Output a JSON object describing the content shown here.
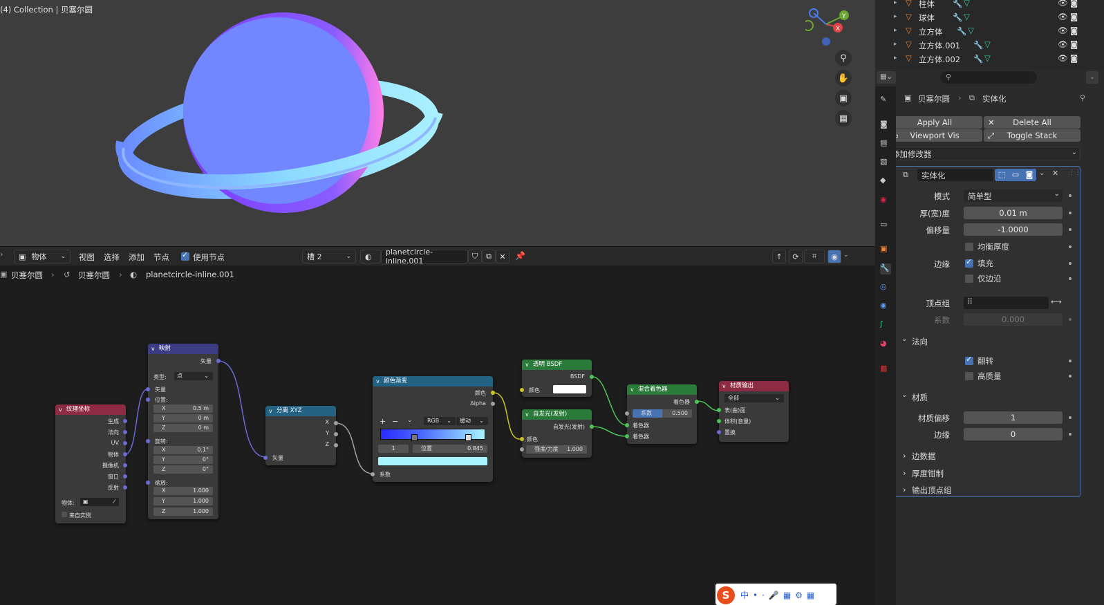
{
  "viewport": {
    "title": "(4) Collection | 贝塞尔圆"
  },
  "node_header": {
    "mode_label": "物体",
    "menu": [
      "视图",
      "选择",
      "添加",
      "节点"
    ],
    "use_nodes_label": "使用节点",
    "slot_label": "槽 2",
    "material_name": "planetcircle-inline.001"
  },
  "breadcrumb": {
    "object": "贝塞尔圆",
    "curve": "贝塞尔圆",
    "material": "planetcircle-inline.001"
  },
  "outliner": {
    "items": [
      {
        "name": "柱体"
      },
      {
        "name": "球体"
      },
      {
        "name": "立方体"
      },
      {
        "name": "立方体.001"
      },
      {
        "name": "立方体.002"
      }
    ]
  },
  "properties": {
    "breadcrumb_object": "贝塞尔圆",
    "breadcrumb_modifier": "实体化",
    "apply_all": "Apply All",
    "delete_all": "Delete All",
    "viewport_vis": "Viewport Vis",
    "toggle_stack": "Toggle Stack",
    "add_modifier": "添加修改器",
    "modifier_name": "实体化",
    "mode_label": "模式",
    "mode_value": "简单型",
    "thickness_label": "厚(宽)度",
    "thickness_value": "0.01 m",
    "offset_label": "偏移量",
    "offset_value": "-1.0000",
    "even_label": "均衡厚度",
    "rim_label": "边缘",
    "fill_label": "填充",
    "rim_only_label": "仅边沿",
    "vgroup_label": "顶点组",
    "factor_label": "系数",
    "factor_value": "0.000",
    "normals_section": "法向",
    "flip_label": "翻转",
    "hq_label": "高质量",
    "material_section": "材质",
    "mat_offset_label": "材质偏移",
    "mat_offset_value": "1",
    "rim_mat_label": "边缘",
    "rim_mat_value": "0",
    "edge_data_section": "边数据",
    "thickness_clamp_section": "厚度钳制",
    "output_vgroups_section": "输出顶点组"
  },
  "nodes": {
    "texcoord": {
      "title": "纹理坐标",
      "outputs": [
        "生成",
        "法向",
        "UV",
        "物体",
        "摄像机",
        "窗口",
        "反射"
      ],
      "object_label": "物体:",
      "instancer_label": "来自实例"
    },
    "mapping": {
      "title": "映射",
      "out": "矢量",
      "type_label": "类型:",
      "type_value": "点",
      "vector": "矢量",
      "location": "位置:",
      "rotation": "旋转:",
      "scale": "缩放:",
      "loc": [
        {
          "a": "X",
          "v": "0.5 m"
        },
        {
          "a": "Y",
          "v": "0 m"
        },
        {
          "a": "Z",
          "v": "0 m"
        }
      ],
      "rot": [
        {
          "a": "X",
          "v": "0.1°"
        },
        {
          "a": "Y",
          "v": "0°"
        },
        {
          "a": "Z",
          "v": "0°"
        }
      ],
      "scl": [
        {
          "a": "X",
          "v": "1.000"
        },
        {
          "a": "Y",
          "v": "1.000"
        },
        {
          "a": "Z",
          "v": "1.000"
        }
      ]
    },
    "separate": {
      "title": "分离 XYZ",
      "x": "X",
      "y": "Y",
      "z": "Z",
      "vector": "矢量"
    },
    "ramp": {
      "title": "颜色渐变",
      "color": "颜色",
      "alpha": "Alpha",
      "mode": "RGB",
      "interp": "缓动",
      "stop_index": "1",
      "pos_label": "位置",
      "pos_value": "0.845",
      "fac": "系数"
    },
    "transparent": {
      "title": "透明 BSDF",
      "out": "BSDF",
      "color": "颜色"
    },
    "emission": {
      "title": "自发光(发射)",
      "out": "自发光(发射)",
      "color": "颜色",
      "strength_label": "强度/力度",
      "strength_value": "1.000"
    },
    "mix": {
      "title": "混合着色器",
      "out": "着色器",
      "fac_label": "系数",
      "fac_value": "0.500",
      "in1": "着色器",
      "in2": "着色器"
    },
    "output": {
      "title": "材质输出",
      "target": "全部",
      "surface": "表(曲)面",
      "volume": "体积(音量)",
      "displacement": "置换"
    }
  },
  "colors": {
    "accent": "#4772b3",
    "node_bg": "#3a3a3a",
    "viewport_bg": "#3d3d3d"
  }
}
